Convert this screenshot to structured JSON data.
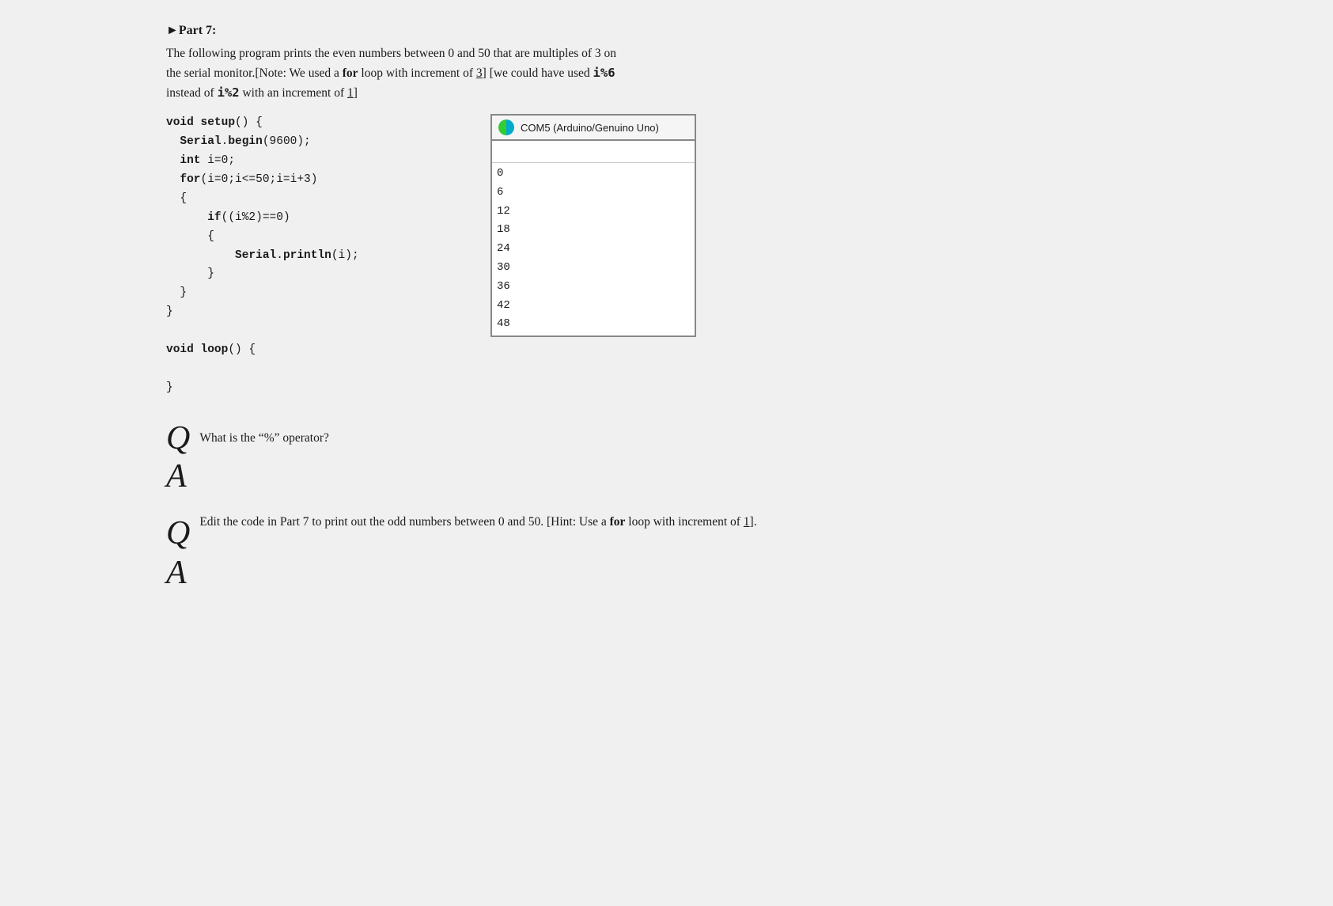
{
  "page": {
    "background": "#f0f0f0"
  },
  "part": {
    "heading": "Part 7:",
    "description_line1": "The following program prints the even numbers between 0 and 50 that are multiples of 3 on",
    "description_line2": "the serial monitor.[Note: We used a for loop with increment of 3] [we could have used i%6",
    "description_line3": "instead of i%2 with an increment of 1]"
  },
  "code": {
    "lines": [
      "void setup() {",
      "  Serial.begin(9600);",
      "  int i=0;",
      "  for(i=0;i<=50;i=i+3)",
      "  {",
      "      if((i%2)==0)",
      "      {",
      "          Serial.println(i);",
      "      }",
      "  }",
      "}",
      "",
      "void loop() {",
      "",
      "}"
    ]
  },
  "serial_monitor": {
    "title": "COM5 (Arduino/Genuino Uno)",
    "icon_color1": "#00aacc",
    "icon_color2": "#33cc33",
    "output": [
      "0",
      "6",
      "12",
      "18",
      "24",
      "30",
      "36",
      "42",
      "48"
    ]
  },
  "qa": [
    {
      "id": "q1",
      "question": "What is the “%” operator?",
      "answer": ""
    },
    {
      "id": "q2",
      "question": "Edit the code in Part 7 to print out the odd numbers between 0 and 50. [Hint: Use a for loop with increment of 1].",
      "answer": ""
    }
  ],
  "labels": {
    "q": "Q",
    "a": "A"
  }
}
